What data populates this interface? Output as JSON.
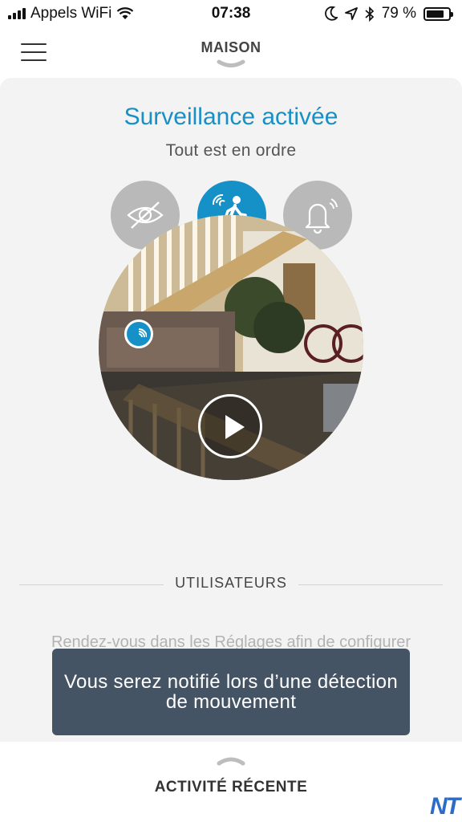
{
  "status_bar": {
    "carrier": "Appels WiFi",
    "time": "07:38",
    "battery_percent": "79 %",
    "battery_level": 0.79
  },
  "header": {
    "title": "MAISON"
  },
  "surveillance": {
    "title": "Surveillance activée",
    "subtitle": "Tout est en ordre"
  },
  "modes": [
    {
      "name": "privacy",
      "icon": "eye-off-icon",
      "active": false
    },
    {
      "name": "motion",
      "icon": "motion-detection-icon",
      "active": true
    },
    {
      "name": "alarm",
      "icon": "bell-icon",
      "active": false
    }
  ],
  "users_section": {
    "label": "UTILISATEURS",
    "hint": "Rendez-vous dans les Réglages afin de configurer"
  },
  "toast": {
    "message": "Vous serez notifié lors d’une détection de mouvement"
  },
  "bottom_bar": {
    "label": "ACTIVITÉ RÉCENTE"
  },
  "watermark": "NT",
  "colors": {
    "accent": "#1691c7",
    "title_blue": "#1a8fc4",
    "toast_bg": "#455465",
    "inactive_button": "#b9b9b9"
  }
}
